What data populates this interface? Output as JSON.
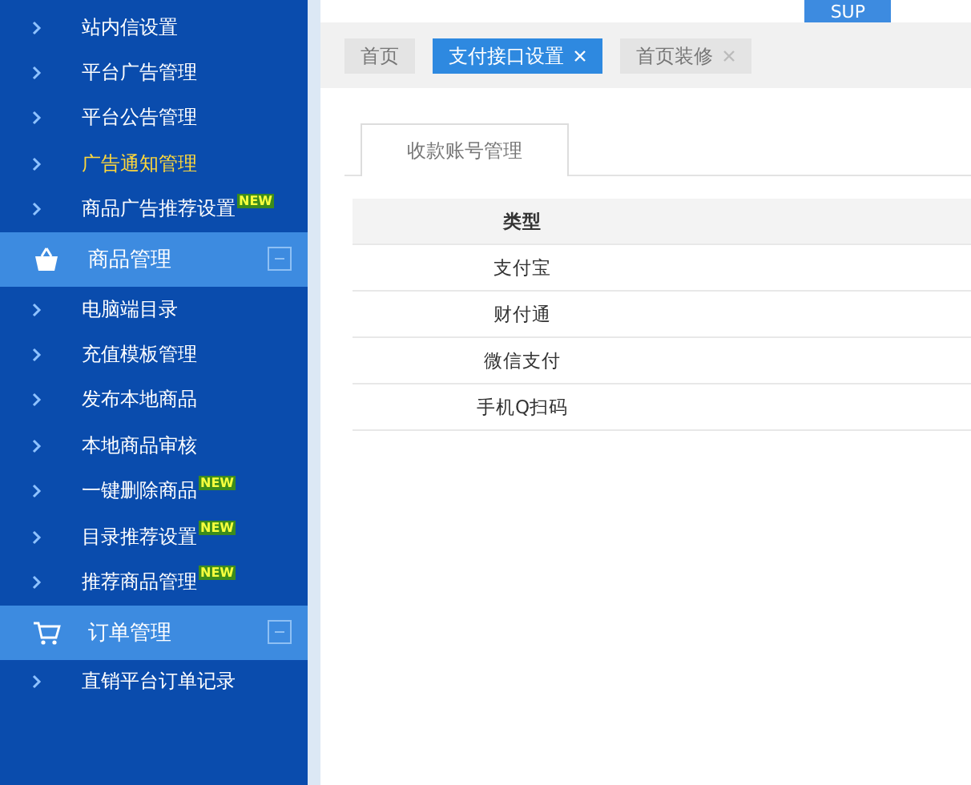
{
  "top_bar": {
    "button": "SUP"
  },
  "sidebar": {
    "items": [
      {
        "kind": "item",
        "label": "站内信设置",
        "selected": false
      },
      {
        "kind": "item",
        "label": "平台广告管理",
        "selected": false
      },
      {
        "kind": "item",
        "label": "平台公告管理",
        "selected": false
      },
      {
        "kind": "item",
        "label": "广告通知管理",
        "selected": true
      },
      {
        "kind": "item",
        "label": "商品广告推荐设置",
        "selected": false,
        "badge": "NEW"
      },
      {
        "kind": "section",
        "label": "商品管理"
      },
      {
        "kind": "item",
        "label": "电脑端目录",
        "selected": false
      },
      {
        "kind": "item",
        "label": "充值模板管理",
        "selected": false
      },
      {
        "kind": "item",
        "label": "发布本地商品",
        "selected": false
      },
      {
        "kind": "item",
        "label": "本地商品审核",
        "selected": false
      },
      {
        "kind": "item",
        "label": "一键删除商品",
        "selected": false,
        "badge": "NEW"
      },
      {
        "kind": "item",
        "label": "目录推荐设置",
        "selected": false,
        "badge": "NEW"
      },
      {
        "kind": "item",
        "label": "推荐商品管理",
        "selected": false,
        "badge": "NEW"
      },
      {
        "kind": "section",
        "label": "订单管理"
      },
      {
        "kind": "item",
        "label": "直销平台订单记录",
        "selected": false
      }
    ]
  },
  "page_tabs": [
    {
      "label": "首页",
      "selected": false,
      "closable": false
    },
    {
      "label": "支付接口设置",
      "selected": true,
      "closable": true
    },
    {
      "label": "首页装修",
      "selected": false,
      "closable": true
    }
  ],
  "panel": {
    "tabs": [
      {
        "label": "收款账号管理"
      }
    ],
    "table": {
      "columns": [
        "类型"
      ],
      "rows": [
        [
          "支付宝"
        ],
        [
          "财付通"
        ],
        [
          "微信支付"
        ],
        [
          "手机Q扫码"
        ]
      ]
    }
  }
}
